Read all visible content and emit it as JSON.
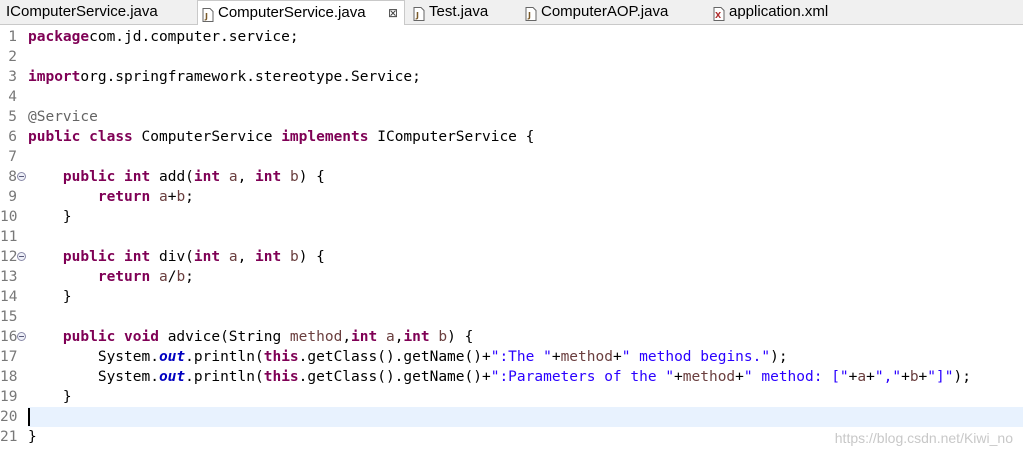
{
  "tabs": [
    {
      "label": "IComputerService.java",
      "icon": "interface-file-icon",
      "active": false
    },
    {
      "label": "ComputerService.java",
      "icon": "java-file-icon",
      "active": true,
      "close": "⊠"
    },
    {
      "label": "Test.java",
      "icon": "java-file-icon",
      "active": false
    },
    {
      "label": "ComputerAOP.java",
      "icon": "java-file-icon",
      "active": false
    },
    {
      "label": "application.xml",
      "icon": "xml-file-icon",
      "active": false
    }
  ],
  "editor": {
    "current_line": 20,
    "fold_lines": [
      8,
      12,
      16
    ],
    "lines": [
      [
        [
          "kw",
          "package"
        ],
        [
          "",
          "com.jd.computer.service;"
        ]
      ],
      [],
      [
        [
          "kw",
          "import"
        ],
        [
          "",
          "org.springframework.stereotype.Service;"
        ]
      ],
      [],
      [
        [
          "ann",
          "@Service"
        ]
      ],
      [
        [
          "kw",
          "public"
        ],
        [
          "",
          " "
        ],
        [
          "kw",
          "class"
        ],
        [
          "",
          " ComputerService "
        ],
        [
          "kw",
          "implements"
        ],
        [
          "",
          " IComputerService {"
        ]
      ],
      [],
      [
        [
          "",
          "    "
        ],
        [
          "kw",
          "public"
        ],
        [
          "",
          " "
        ],
        [
          "kw",
          "int"
        ],
        [
          "",
          " add("
        ],
        [
          "kw",
          "int"
        ],
        [
          "",
          " "
        ],
        [
          "param",
          "a"
        ],
        [
          "",
          ", "
        ],
        [
          "kw",
          "int"
        ],
        [
          "",
          " "
        ],
        [
          "param",
          "b"
        ],
        [
          "",
          ") {"
        ]
      ],
      [
        [
          "",
          "        "
        ],
        [
          "kw",
          "return"
        ],
        [
          "",
          " "
        ],
        [
          "param",
          "a"
        ],
        [
          "",
          "+"
        ],
        [
          "param",
          "b"
        ],
        [
          "",
          ";"
        ]
      ],
      [
        [
          "",
          "    }"
        ]
      ],
      [],
      [
        [
          "",
          "    "
        ],
        [
          "kw",
          "public"
        ],
        [
          "",
          " "
        ],
        [
          "kw",
          "int"
        ],
        [
          "",
          " div("
        ],
        [
          "kw",
          "int"
        ],
        [
          "",
          " "
        ],
        [
          "param",
          "a"
        ],
        [
          "",
          ", "
        ],
        [
          "kw",
          "int"
        ],
        [
          "",
          " "
        ],
        [
          "param",
          "b"
        ],
        [
          "",
          ") {"
        ]
      ],
      [
        [
          "",
          "        "
        ],
        [
          "kw",
          "return"
        ],
        [
          "",
          " "
        ],
        [
          "param",
          "a"
        ],
        [
          "",
          "/"
        ],
        [
          "param",
          "b"
        ],
        [
          "",
          ";"
        ]
      ],
      [
        [
          "",
          "    }"
        ]
      ],
      [],
      [
        [
          "",
          "    "
        ],
        [
          "kw",
          "public"
        ],
        [
          "",
          " "
        ],
        [
          "kw",
          "void"
        ],
        [
          "",
          " advice(String "
        ],
        [
          "param",
          "method"
        ],
        [
          "",
          ","
        ],
        [
          "kw",
          "int"
        ],
        [
          "",
          " "
        ],
        [
          "param",
          "a"
        ],
        [
          "",
          ","
        ],
        [
          "kw",
          "int"
        ],
        [
          "",
          " "
        ],
        [
          "param",
          "b"
        ],
        [
          "",
          ") {"
        ]
      ],
      [
        [
          "",
          "        System."
        ],
        [
          "static",
          "out"
        ],
        [
          "",
          ".println("
        ],
        [
          "kw",
          "this"
        ],
        [
          "",
          ".getClass().getName()+"
        ],
        [
          "str",
          "\":The \""
        ],
        [
          "",
          "+"
        ],
        [
          "param",
          "method"
        ],
        [
          "",
          "+"
        ],
        [
          "str",
          "\" method begins.\""
        ],
        [
          "",
          ");"
        ]
      ],
      [
        [
          "",
          "        System."
        ],
        [
          "static",
          "out"
        ],
        [
          "",
          ".println("
        ],
        [
          "kw",
          "this"
        ],
        [
          "",
          ".getClass().getName()+"
        ],
        [
          "str",
          "\":Parameters of the \""
        ],
        [
          "",
          "+"
        ],
        [
          "param",
          "method"
        ],
        [
          "",
          "+"
        ],
        [
          "str",
          "\" method: [\""
        ],
        [
          "",
          "+"
        ],
        [
          "param",
          "a"
        ],
        [
          "",
          "+"
        ],
        [
          "str",
          "\",\""
        ],
        [
          "",
          "+"
        ],
        [
          "param",
          "b"
        ],
        [
          "",
          "+"
        ],
        [
          "str",
          "\"]\""
        ],
        [
          "",
          ");"
        ]
      ],
      [
        [
          "",
          "    }"
        ]
      ],
      [],
      [
        [
          "",
          "}"
        ]
      ]
    ]
  },
  "watermark": "https://blog.csdn.net/Kiwi_no"
}
